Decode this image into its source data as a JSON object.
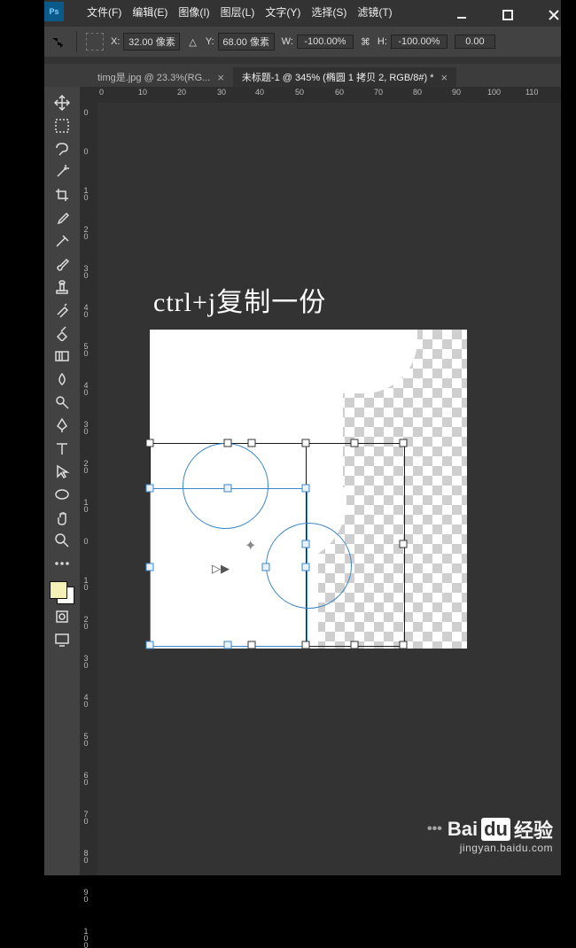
{
  "menu": {
    "items": [
      "文件(F)",
      "编辑(E)",
      "图像(I)",
      "图层(L)",
      "文字(Y)",
      "选择(S)",
      "滤镜(T)"
    ]
  },
  "winctl": {
    "min": "—",
    "max": "□",
    "close": "×"
  },
  "options": {
    "x": {
      "label": "X:",
      "value": "32.00 像素"
    },
    "y": {
      "label": "Y:",
      "value": "68.00 像素"
    },
    "w": {
      "label": "W:",
      "value": "-100.00%"
    },
    "h": {
      "label": "H:",
      "value": "-100.00%"
    },
    "angle": {
      "value": "0.00"
    },
    "delta": "△",
    "link": "⌘"
  },
  "tabs": {
    "tab1": {
      "label": "timg是.jpg @ 23.3%(RG...",
      "close": "×"
    },
    "tab2": {
      "label": "未标题-1 @ 345% (椭圆 1 拷贝 2, RGB/8#) *",
      "close": "×"
    }
  },
  "ruler_h": {
    "ticks": [
      "0",
      "10",
      "20",
      "30",
      "40",
      "50",
      "60",
      "70",
      "80",
      "90",
      "100",
      "110"
    ]
  },
  "ruler_v": {
    "ticks": [
      "0",
      "0",
      "10",
      "20",
      "30",
      "40",
      "50",
      "40",
      "30",
      "20",
      "10",
      "0",
      "10",
      "20",
      "30",
      "40",
      "50",
      "60",
      "70",
      "80",
      "90",
      "100"
    ]
  },
  "overlay": "ctrl+j复制一份",
  "tools": [
    "move",
    "marquee",
    "lasso",
    "wand",
    "crop",
    "eyedrop",
    "heal",
    "brush",
    "stamp",
    "history",
    "eraser",
    "gradient",
    "blur",
    "dodge",
    "pen",
    "type",
    "path",
    "ellipse",
    "hand",
    "zoom",
    "more"
  ],
  "watermark": {
    "brand_a": "Bai",
    "brand_b": "du",
    "brand_c": "经验",
    "url": "jingyan.baidu.com",
    "paws": "•••"
  }
}
